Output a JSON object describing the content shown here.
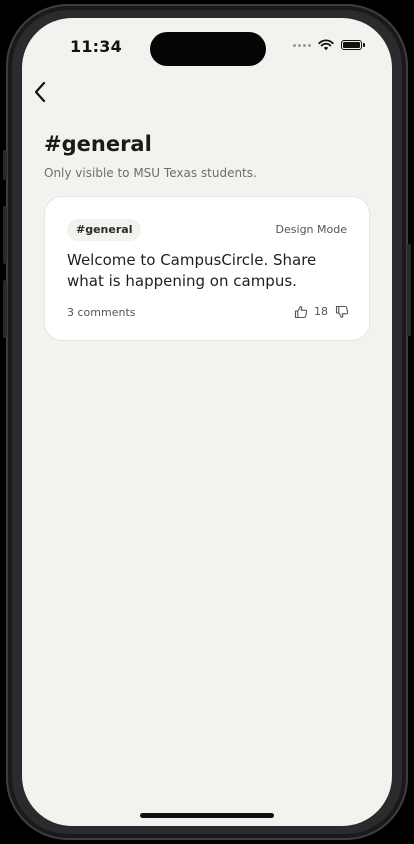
{
  "status_bar": {
    "time": "11:34"
  },
  "nav": {
    "back_icon": "chevron-left-icon"
  },
  "header": {
    "title": "#general",
    "subtitle": "Only visible to MSU Texas students."
  },
  "post": {
    "tag": "#general",
    "mode": "Design Mode",
    "text": "Welcome to CampusCircle. Share what is happening on campus.",
    "comments": "3 comments",
    "votes": "18"
  },
  "colors": {
    "background": "#f3f2ee",
    "card": "#ffffff",
    "text": "#1a1a1a"
  }
}
